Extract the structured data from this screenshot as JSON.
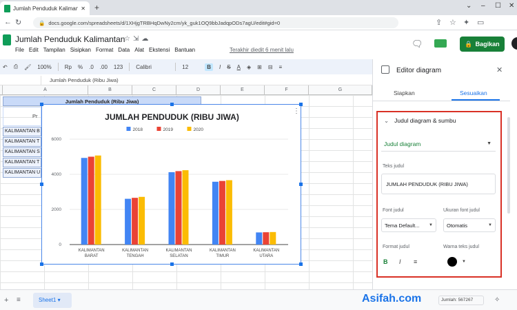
{
  "browser": {
    "tab_title": "Jumlah Penduduk Kalimantan - G",
    "url": "docs.google.com/spreadsheets/d/1XHjgTRBHqDwNy2cm/yk_guk1OQ9bbJadqpODs7agU/edit#gid=0"
  },
  "doc": {
    "title": "Jumlah Penduduk Kalimantan",
    "menu": [
      "File",
      "Edit",
      "Tampilan",
      "Sisipkan",
      "Format",
      "Data",
      "Alat",
      "Ekstensi",
      "Bantuan"
    ],
    "last_edit": "Terakhir diedit 6 menit lalu",
    "share_label": "Bagikan"
  },
  "toolbar": {
    "zoom": "100%",
    "currency": "Rp",
    "percent": "%",
    "dec_less": ".0",
    "dec_more": ".00",
    "num_format": "123",
    "font": "Calibri",
    "font_size": "12",
    "bold": "B",
    "italic": "I",
    "strike": "S",
    "text_color": "A"
  },
  "formula_bar": {
    "value": "Jumlah Penduduk (Ribu Jiwa)"
  },
  "grid": {
    "columns": [
      "A",
      "B",
      "C",
      "D",
      "E",
      "F",
      "G"
    ],
    "header_cell": "Jumlah Penduduk (Ribu Jiwa)",
    "p_cell": "Pr",
    "rows": [
      "KALIMANTAN B",
      "KALIMANTAN T",
      "KALIMANTAN S",
      "KALIMANTAN T",
      "KALIMANTAN U"
    ]
  },
  "chart_data": {
    "type": "bar",
    "title": "JUMLAH PENDUDUK (RIBU JIWA)",
    "categories": [
      [
        "KALIMANTAN",
        "BARAT"
      ],
      [
        "KALIMANTAN",
        "TENGAH"
      ],
      [
        "KALIMANTAN",
        "SELATAN"
      ],
      [
        "KALIMANTAN",
        "TIMUR"
      ],
      [
        "KALIMANTAN",
        "UTARA"
      ]
    ],
    "series": [
      {
        "name": "2018",
        "color": "#4285f4",
        "values": [
          4932,
          2605,
          4120,
          3576,
          691
        ]
      },
      {
        "name": "2019",
        "color": "#ea4335",
        "values": [
          5001,
          2660,
          4180,
          3621,
          701
        ]
      },
      {
        "name": "2020",
        "color": "#fbbc04",
        "values": [
          5069,
          2715,
          4232,
          3664,
          713
        ]
      }
    ],
    "ylim": [
      0,
      6000
    ],
    "yticks": [
      0,
      2000,
      4000,
      6000
    ],
    "legend": "top",
    "grid": true
  },
  "editor": {
    "title": "Editor diagram",
    "tab_setup": "Siapkan",
    "tab_customize": "Sesuaikan",
    "section_title": "Judul diagram & sumbu",
    "chart_title_dropdown": "Judul diagram",
    "label_title_text": "Teks judul",
    "title_text_value": "JUMLAH PENDUDUK (RIBU JIWA)",
    "label_title_font": "Font judul",
    "label_title_font_size": "Ukuran font judul",
    "font_value": "Tema Default...",
    "font_size_value": "Otomatis",
    "label_title_format": "Format judul",
    "label_title_color": "Warna teks judul",
    "format_bold": "B",
    "format_italic": "I",
    "format_align": "≡"
  },
  "bottom": {
    "sheet_name": "Sheet1",
    "watermark": "Asifah.com",
    "sum_label": "Jumlah: 567267"
  }
}
